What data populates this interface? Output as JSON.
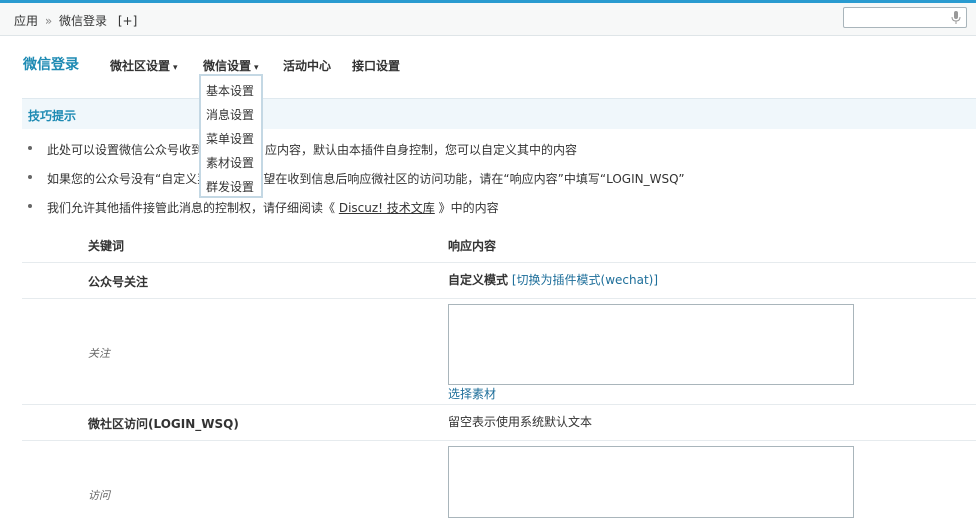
{
  "header": {
    "breadcrumb": [
      "应用",
      "»",
      "微信登录"
    ],
    "add_label": "[+]",
    "search": {
      "placeholder": "",
      "value": ""
    }
  },
  "plugin": {
    "title": "微信登录"
  },
  "nav": {
    "items": [
      {
        "label": "微社区设置",
        "has_caret": true
      },
      {
        "label": "微信设置",
        "has_caret": true
      },
      {
        "label": "活动中心",
        "has_caret": false
      },
      {
        "label": "接口设置",
        "has_caret": false
      }
    ],
    "caret": "▾",
    "dropdown": [
      "基本设置",
      "消息设置",
      "菜单设置",
      "素材设置",
      "群发设置"
    ]
  },
  "tips": {
    "title": "技巧提示",
    "items": [
      {
        "text": "此处可以设置微信公众号收到"
      },
      {
        "text": "如果您的公众号没有“自定义菜单”并且希望在收到信息后响应微社区的访问功能，请在“响应内容”中填写“LOGIN_WSQ”"
      },
      {
        "before": "我们允许其他插件接管此消息的控制权，请仔细阅读《 ",
        "link": "Discuz! 技术文库",
        "after": " 》中的内容"
      }
    ],
    "tip1_right": "应内容，默认由本插件自身控制，您可以自定义其中的内容"
  },
  "table": {
    "headers": {
      "keyword": "关键词",
      "response": "响应内容"
    },
    "rows": {
      "follow_group": "公众号关注",
      "mode_label": "自定义模式",
      "mode_switch": "[切换为插件模式(wechat)]",
      "follow_label": "关注",
      "select_material": "选择素材",
      "visit_group": "微社区访问(LOGIN_WSQ)",
      "visit_hint": "留空表示使用系统默认文本",
      "visit_label": "访问"
    }
  },
  "colors": {
    "accent": "#1d8ab3",
    "topline": "#2a9bd0",
    "tips_bg": "#f0f7fb"
  },
  "icons": {
    "search": "microphone-icon"
  }
}
